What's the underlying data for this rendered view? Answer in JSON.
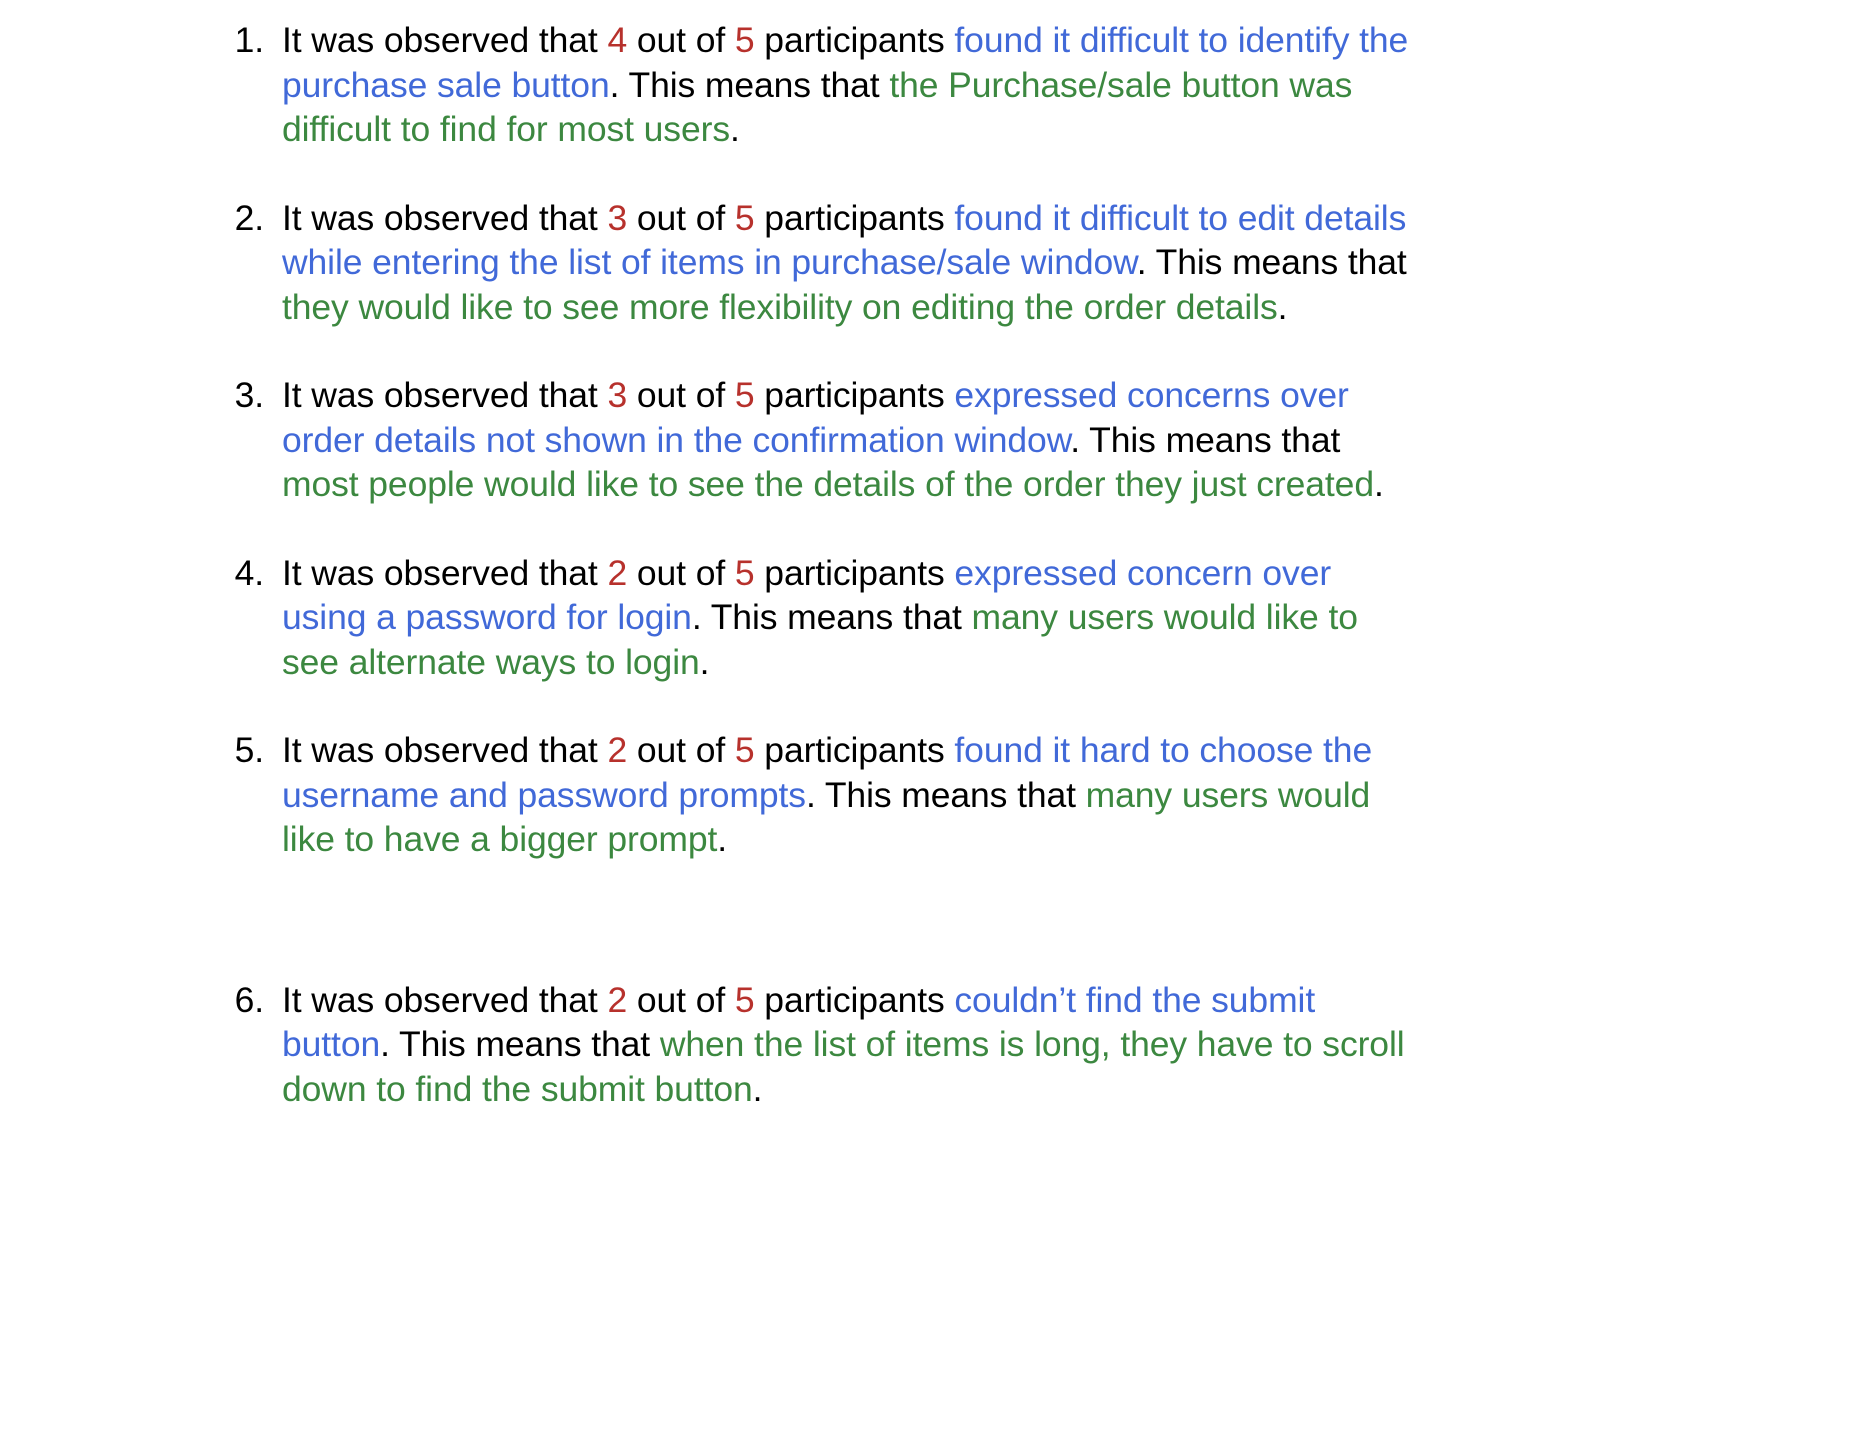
{
  "document": {
    "type": "usability-findings-list",
    "colors": {
      "plain_text": "#000000",
      "participant_count": "#b7312c",
      "observation": "#4169d8",
      "interpretation": "#3c8840",
      "background": "#ffffff"
    },
    "findings": [
      {
        "marker": "1.",
        "lead_in": "It was observed that ",
        "count": "4",
        "out_of": " out of ",
        "total": "5",
        "participants_word": " participants ",
        "observation": "found it difficult to identify the purchase sale button",
        "connector": ". This means that ",
        "interpretation": "the Purchase/sale button was difficult to find for most users",
        "end_punctuation": "."
      },
      {
        "marker": "2.",
        "lead_in": "It was observed that ",
        "count": "3",
        "out_of": " out of ",
        "total": "5",
        "participants_word": " participants ",
        "observation": "found it difficult to edit details while entering the list of items in purchase/sale window",
        "connector": ". This means that ",
        "interpretation": "they would like to see more flexibility on editing the order details",
        "end_punctuation": "."
      },
      {
        "marker": "3.",
        "lead_in": "It was observed that ",
        "count": "3",
        "out_of": " out of ",
        "total": "5",
        "participants_word": " participants ",
        "observation": "expressed concerns over order details not shown in the confirmation window",
        "connector": ". This means that ",
        "interpretation": "most people would like to see the details of the order they just created",
        "end_punctuation": "."
      },
      {
        "marker": "4.",
        "lead_in": "It was observed that ",
        "count": "2",
        "out_of": " out of ",
        "total": "5",
        "participants_word": " participants ",
        "observation": "expressed concern over using a password for login",
        "connector": ". This means that ",
        "interpretation": "many users would like to see alternate ways to login",
        "end_punctuation": "."
      },
      {
        "marker": "5.",
        "lead_in": "It was observed that ",
        "count": "2",
        "out_of": " out of ",
        "total": "5",
        "participants_word": " participants ",
        "observation": "found it hard to choose the username and password prompts",
        "connector": ". This means that ",
        "interpretation": "many users would like to have a bigger prompt",
        "end_punctuation": "."
      },
      {
        "marker": "6.",
        "lead_in": "It was observed that ",
        "count": "2",
        "out_of": " out of ",
        "total": "5",
        "participants_word": " participants ",
        "observation": "couldn’t find the submit button",
        "connector": ". This means that ",
        "interpretation": "when the list of items is long, they have to scroll down to find the submit button",
        "end_punctuation": "."
      }
    ]
  }
}
